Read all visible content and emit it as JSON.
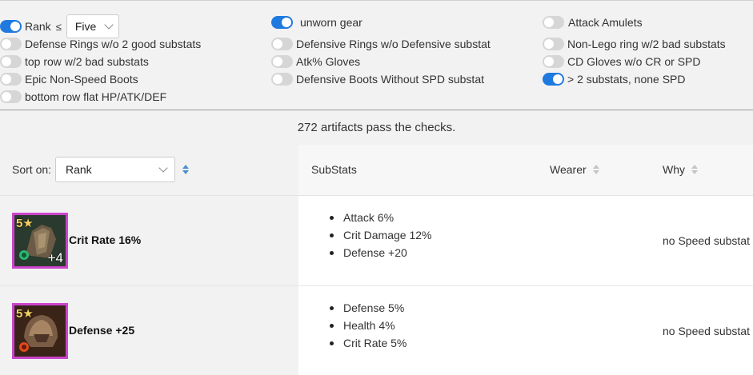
{
  "filters": {
    "rank": {
      "label": "Rank",
      "op": "≤",
      "value": "Five",
      "on": true
    },
    "col1": [
      {
        "label": "Defense Rings w/o 2 good substats",
        "on": false
      },
      {
        "label": "top row w/2 bad substats",
        "on": false
      },
      {
        "label": "Epic Non-Speed Boots",
        "on": false
      },
      {
        "label": "bottom row flat HP/ATK/DEF",
        "on": false
      }
    ],
    "col2": [
      {
        "label": "unworn gear",
        "on": true
      },
      {
        "label": "Defensive Rings w/o Defensive substat",
        "on": false
      },
      {
        "label": "Atk% Gloves",
        "on": false
      },
      {
        "label": "Defensive Boots Without SPD substat",
        "on": false
      }
    ],
    "col3": [
      {
        "label": "Attack Amulets",
        "on": false
      },
      {
        "label": "Non-Lego ring w/2 bad substats",
        "on": false
      },
      {
        "label": "CD Gloves w/o CR or SPD",
        "on": false
      },
      {
        "label": "> 2 substats, none SPD",
        "on": true
      }
    ]
  },
  "summary": "272 artifacts pass the checks.",
  "table": {
    "sort_label": "Sort on:",
    "sort_value": "Rank",
    "headers": {
      "substats": "SubStats",
      "wearer": "Wearer",
      "why": "Why"
    },
    "rows": [
      {
        "stars": "5★",
        "level": "+4",
        "main_stat": "Crit Rate 16%",
        "substats": [
          "Attack 6%",
          "Crit Damage 12%",
          "Defense +20"
        ],
        "wearer": "",
        "why": "no Speed substat",
        "icon": "gauntlets-icon"
      },
      {
        "stars": "5★",
        "level": "",
        "main_stat": "Defense +25",
        "substats": [
          "Defense 5%",
          "Health 4%",
          "Crit Rate 5%"
        ],
        "wearer": "",
        "why": "no Speed substat",
        "icon": "helmet-icon"
      }
    ]
  },
  "colors": {
    "accent": "#1f7ae0",
    "frame": "#cc44cc"
  }
}
